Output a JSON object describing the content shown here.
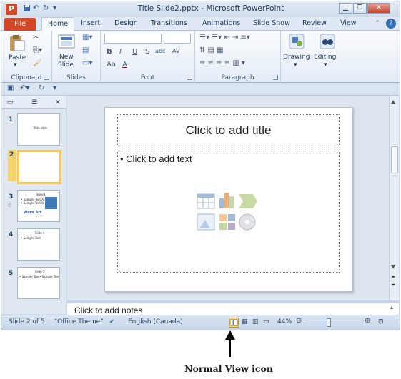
{
  "window": {
    "title": "Title Slide2.pptx - Microsoft PowerPoint",
    "app_icon": "P"
  },
  "window_buttons": {
    "minimize": "▁",
    "restore": "❐",
    "close": "✕"
  },
  "tabs": {
    "file": "File",
    "items": [
      "Home",
      "Insert",
      "Design",
      "Transitions",
      "Animations",
      "Slide Show",
      "Review",
      "View"
    ],
    "active": "Home"
  },
  "ribbon": {
    "clipboard": {
      "paste": "Paste",
      "label": "Clipboard"
    },
    "slides": {
      "new_slide_line1": "New",
      "new_slide_line2": "Slide",
      "label": "Slides"
    },
    "font": {
      "label": "Font",
      "bold": "B",
      "italic": "I",
      "underline": "U",
      "shadow": "S",
      "strike": "abc",
      "spacing": "AV",
      "case": "Aa",
      "color": "A"
    },
    "paragraph": {
      "label": "Paragraph"
    },
    "drawing": {
      "label": "Drawing"
    },
    "editing": {
      "label": "Editing"
    }
  },
  "outline_pane": {
    "slides": [
      {
        "number": "1",
        "title": "Title slide"
      },
      {
        "number": "2",
        "title": ""
      },
      {
        "number": "3",
        "title": "Slide3",
        "body1": "• Sample Text A",
        "body2": "• Sample Text B",
        "footer": "Word Art"
      },
      {
        "number": "4",
        "title": "Slide 4",
        "body1": "• Sample Text"
      },
      {
        "number": "5",
        "title": "Slide 5",
        "body1": "• Sample Text",
        "body2": "• Sample Text"
      }
    ],
    "selected_index": 1
  },
  "slide": {
    "title_placeholder": "Click to add title",
    "text_placeholder": "• Click to add text"
  },
  "notes": {
    "placeholder": "Click to add notes"
  },
  "status": {
    "slide_info": "Slide 2 of 5",
    "theme": "\"Office Theme\"",
    "language": "English (Canada)",
    "zoom": "44%",
    "zoom_fraction": 0.4
  },
  "caption": "Normal View icon",
  "colors": {
    "accent_file": "#d24726",
    "selected_thumb": "#f5c85c"
  }
}
